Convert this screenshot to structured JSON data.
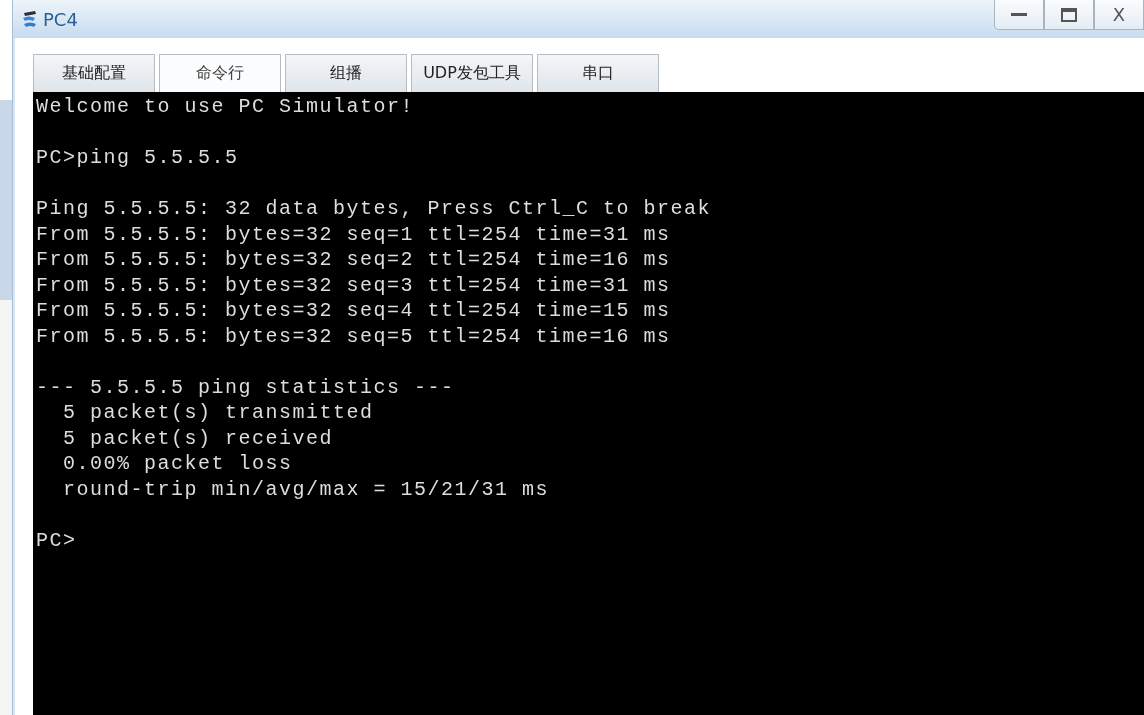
{
  "window": {
    "title": "PC4",
    "controls": [
      {
        "kind": "minimize"
      },
      {
        "kind": "maximize"
      },
      {
        "kind": "close",
        "label": "X"
      }
    ]
  },
  "tabs": [
    {
      "label": "基础配置",
      "selected": false
    },
    {
      "label": "命令行",
      "selected": true
    },
    {
      "label": "组播",
      "selected": false
    },
    {
      "label": "UDP发包工具",
      "selected": false
    },
    {
      "label": "串口",
      "selected": false
    }
  ],
  "terminal": {
    "blocks": [
      [
        "Welcome to use PC Simulator!"
      ],
      [
        "PC>ping 5.5.5.5"
      ],
      [
        "Ping 5.5.5.5: 32 data bytes, Press Ctrl_C to break",
        "From 5.5.5.5: bytes=32 seq=1 ttl=254 time=31 ms",
        "From 5.5.5.5: bytes=32 seq=2 ttl=254 time=16 ms",
        "From 5.5.5.5: bytes=32 seq=3 ttl=254 time=31 ms",
        "From 5.5.5.5: bytes=32 seq=4 ttl=254 time=15 ms",
        "From 5.5.5.5: bytes=32 seq=5 ttl=254 time=16 ms"
      ],
      [
        "--- 5.5.5.5 ping statistics ---",
        "  5 packet(s) transmitted",
        "  5 packet(s) received",
        "  0.00% packet loss",
        "  round-trip min/avg/max = 15/21/31 ms"
      ],
      [
        "PC>"
      ]
    ]
  }
}
